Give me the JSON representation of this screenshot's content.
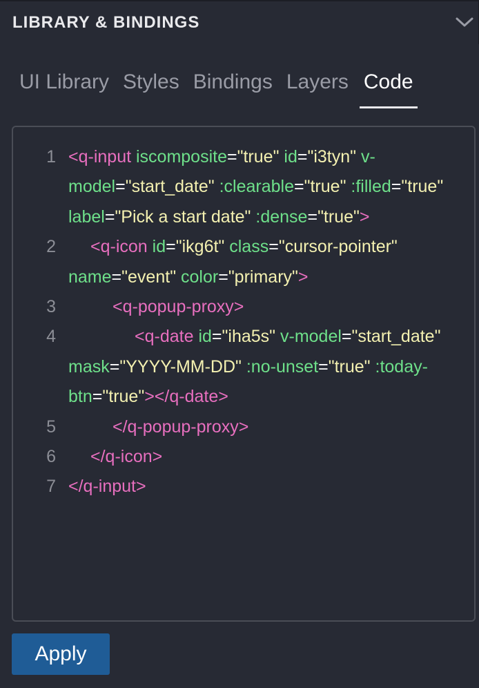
{
  "header": {
    "title": "LIBRARY & BINDINGS",
    "collapse_icon": "chevron-down-icon"
  },
  "tabs": [
    {
      "label": "UI Library",
      "active": false
    },
    {
      "label": "Styles",
      "active": false
    },
    {
      "label": "Bindings",
      "active": false
    },
    {
      "label": "Layers",
      "active": false
    },
    {
      "label": "Code",
      "active": true
    }
  ],
  "colors": {
    "background": "#272a34",
    "tag": "#e86fbf",
    "attribute": "#6ee08a",
    "string": "#f4f1b1",
    "line_number": "#8c8e96",
    "apply_button": "#1f5c96"
  },
  "code": {
    "lines": [
      {
        "number": "1",
        "indent": "",
        "tokens": [
          {
            "t": "tag",
            "v": "<q-input"
          },
          {
            "t": "sp",
            "v": " "
          },
          {
            "t": "attr",
            "v": "iscomposite"
          },
          {
            "t": "eq",
            "v": "="
          },
          {
            "t": "str",
            "v": "\"true\""
          },
          {
            "t": "sp",
            "v": " "
          },
          {
            "t": "attr",
            "v": "id"
          },
          {
            "t": "eq",
            "v": "="
          },
          {
            "t": "str",
            "v": "\"i3tyn\""
          },
          {
            "t": "sp",
            "v": " "
          },
          {
            "t": "attr",
            "v": "v-model"
          },
          {
            "t": "eq",
            "v": "="
          },
          {
            "t": "str",
            "v": "\"start_date\""
          },
          {
            "t": "sp",
            "v": " "
          },
          {
            "t": "attr",
            "v": ":clearable"
          },
          {
            "t": "eq",
            "v": "="
          },
          {
            "t": "str",
            "v": "\"true\""
          },
          {
            "t": "sp",
            "v": " "
          },
          {
            "t": "attr",
            "v": ":filled"
          },
          {
            "t": "eq",
            "v": "="
          },
          {
            "t": "str",
            "v": "\"true\""
          },
          {
            "t": "sp",
            "v": " "
          },
          {
            "t": "attr",
            "v": "label"
          },
          {
            "t": "eq",
            "v": "="
          },
          {
            "t": "str",
            "v": "\"Pick a start date\""
          },
          {
            "t": "sp",
            "v": " "
          },
          {
            "t": "attr",
            "v": ":dense"
          },
          {
            "t": "eq",
            "v": "="
          },
          {
            "t": "str",
            "v": "\"true\""
          },
          {
            "t": "tag",
            "v": ">"
          }
        ]
      },
      {
        "number": "2",
        "indent": "    ",
        "tokens": [
          {
            "t": "tag",
            "v": "<q-icon"
          },
          {
            "t": "sp",
            "v": " "
          },
          {
            "t": "attr",
            "v": "id"
          },
          {
            "t": "eq",
            "v": "="
          },
          {
            "t": "str",
            "v": "\"ikg6t\""
          },
          {
            "t": "sp",
            "v": " "
          },
          {
            "t": "attr",
            "v": "class"
          },
          {
            "t": "eq",
            "v": "="
          },
          {
            "t": "str",
            "v": "\"cursor-pointer\""
          },
          {
            "t": "sp",
            "v": " "
          },
          {
            "t": "attr",
            "v": "name"
          },
          {
            "t": "eq",
            "v": "="
          },
          {
            "t": "str",
            "v": "\"event\""
          },
          {
            "t": "sp",
            "v": " "
          },
          {
            "t": "attr",
            "v": "color"
          },
          {
            "t": "eq",
            "v": "="
          },
          {
            "t": "str",
            "v": "\"primary\""
          },
          {
            "t": "tag",
            "v": ">"
          }
        ]
      },
      {
        "number": "3",
        "indent": "        ",
        "tokens": [
          {
            "t": "tag",
            "v": "<q-popup-proxy>"
          }
        ]
      },
      {
        "number": "4",
        "indent": "            ",
        "tokens": [
          {
            "t": "tag",
            "v": "<q-date"
          },
          {
            "t": "sp",
            "v": " "
          },
          {
            "t": "attr",
            "v": "id"
          },
          {
            "t": "eq",
            "v": "="
          },
          {
            "t": "str",
            "v": "\"iha5s\""
          },
          {
            "t": "sp",
            "v": " "
          },
          {
            "t": "attr",
            "v": "v-model"
          },
          {
            "t": "eq",
            "v": "="
          },
          {
            "t": "str",
            "v": "\"start_date\""
          },
          {
            "t": "sp",
            "v": " "
          },
          {
            "t": "attr",
            "v": "mask"
          },
          {
            "t": "eq",
            "v": "="
          },
          {
            "t": "str",
            "v": "\"YYYY-MM-DD\""
          },
          {
            "t": "sp",
            "v": " "
          },
          {
            "t": "attr",
            "v": ":no-unset"
          },
          {
            "t": "eq",
            "v": "="
          },
          {
            "t": "str",
            "v": "\"true\""
          },
          {
            "t": "sp",
            "v": " "
          },
          {
            "t": "attr",
            "v": ":today-btn"
          },
          {
            "t": "eq",
            "v": "="
          },
          {
            "t": "str",
            "v": "\"true\""
          },
          {
            "t": "tag",
            "v": "></q-date>"
          }
        ]
      },
      {
        "number": "5",
        "indent": "        ",
        "tokens": [
          {
            "t": "tag",
            "v": "</q-popup-proxy>"
          }
        ]
      },
      {
        "number": "6",
        "indent": "    ",
        "tokens": [
          {
            "t": "tag",
            "v": "</q-icon>"
          }
        ]
      },
      {
        "number": "7",
        "indent": "",
        "tokens": [
          {
            "t": "tag",
            "v": "</q-input>"
          }
        ]
      }
    ]
  },
  "footer": {
    "apply_label": "Apply"
  }
}
